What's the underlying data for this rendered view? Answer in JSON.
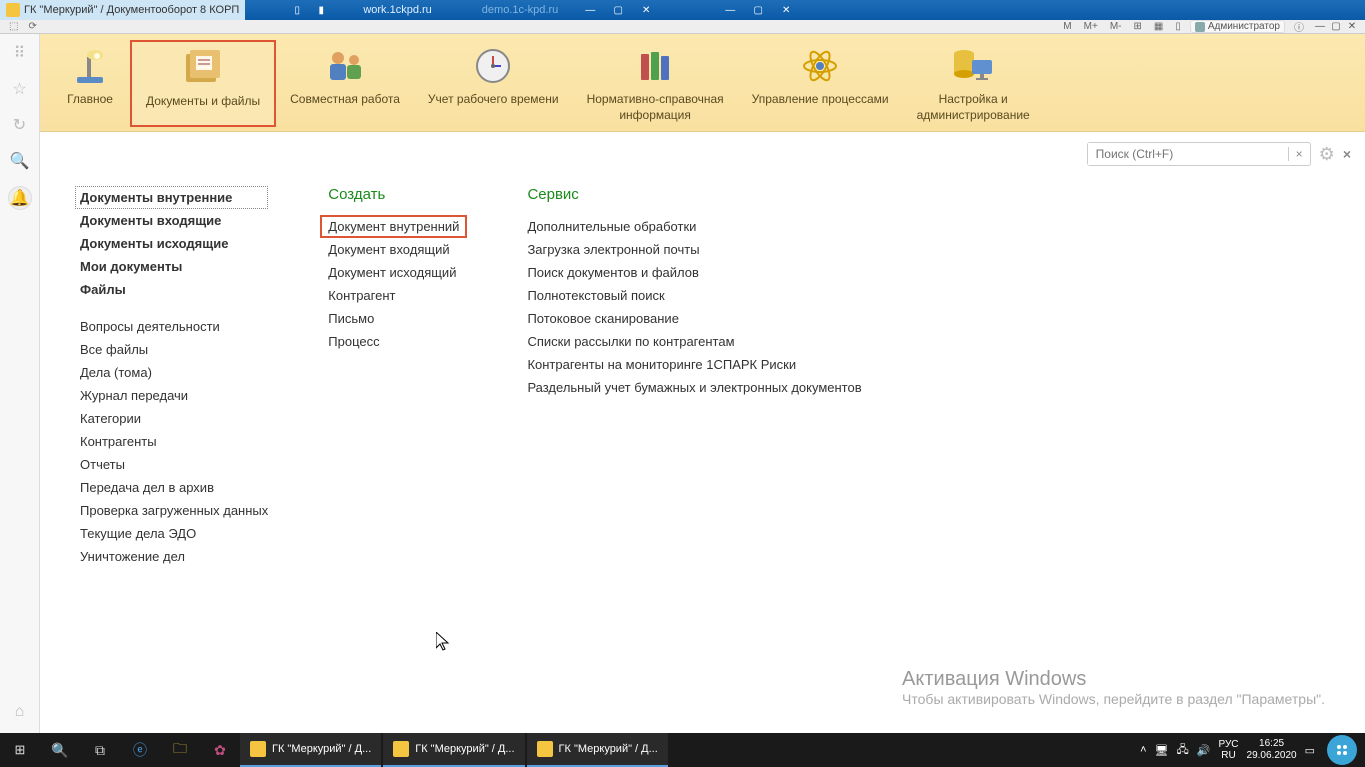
{
  "titlebar": {
    "tab1": "ГК \"Меркурий\" / Документооборот 8 КОРП",
    "addr": "work.1ckpd.ru",
    "faded": "demo.1c-kpd.ru"
  },
  "topbar": {
    "m": "M",
    "mplus": "M+",
    "mminus": "M-",
    "admin": "Администратор"
  },
  "sections": [
    {
      "label": "Главное"
    },
    {
      "label": "Документы и файлы"
    },
    {
      "label": "Совместная работа"
    },
    {
      "label": "Учет рабочего времени"
    },
    {
      "label": "Нормативно-справочная\nинформация"
    },
    {
      "label": "Управление процессами"
    },
    {
      "label": "Настройка и\nадминистрирование"
    }
  ],
  "search": {
    "placeholder": "Поиск (Ctrl+F)"
  },
  "nav": {
    "items": [
      {
        "label": "Документы внутренние",
        "sel": true
      },
      {
        "label": "Документы входящие",
        "bold": true
      },
      {
        "label": "Документы исходящие",
        "bold": true
      },
      {
        "label": "Мои документы",
        "bold": true
      },
      {
        "label": "Файлы",
        "bold": true
      }
    ],
    "items2": [
      {
        "label": "Вопросы деятельности"
      },
      {
        "label": "Все файлы"
      },
      {
        "label": "Дела (тома)"
      },
      {
        "label": "Журнал передачи"
      },
      {
        "label": "Категории"
      },
      {
        "label": "Контрагенты"
      },
      {
        "label": "Отчеты"
      },
      {
        "label": "Передача дел в архив"
      },
      {
        "label": "Проверка загруженных данных"
      },
      {
        "label": "Текущие дела ЭДО"
      },
      {
        "label": "Уничтожение дел"
      }
    ]
  },
  "create": {
    "title": "Создать",
    "items": [
      {
        "label": "Документ внутренний",
        "hl": true
      },
      {
        "label": "Документ входящий"
      },
      {
        "label": "Документ исходящий"
      },
      {
        "label": "Контрагент"
      },
      {
        "label": "Письмо"
      },
      {
        "label": "Процесс"
      }
    ]
  },
  "service": {
    "title": "Сервис",
    "items": [
      {
        "label": "Дополнительные обработки"
      },
      {
        "label": "Загрузка электронной почты"
      },
      {
        "label": "Поиск документов и файлов"
      },
      {
        "label": "Полнотекстовый поиск"
      },
      {
        "label": "Потоковое сканирование"
      },
      {
        "label": "Списки рассылки по контрагентам"
      },
      {
        "label": "Контрагенты на мониторинге 1СПАРК Риски"
      },
      {
        "label": "Раздельный учет бумажных и электронных документов"
      }
    ]
  },
  "watermark": {
    "t1": "Активация Windows",
    "t2": "Чтобы активировать Windows, перейдите в раздел \"Параметры\"."
  },
  "taskbar": {
    "tasks": [
      {
        "label": "ГК \"Меркурий\" / Д..."
      },
      {
        "label": "ГК \"Меркурий\" / Д..."
      },
      {
        "label": "ГК \"Меркурий\" / Д..."
      }
    ],
    "lang1": "РУС",
    "lang2": "RU",
    "time": "16:25",
    "date": "29.06.2020"
  }
}
